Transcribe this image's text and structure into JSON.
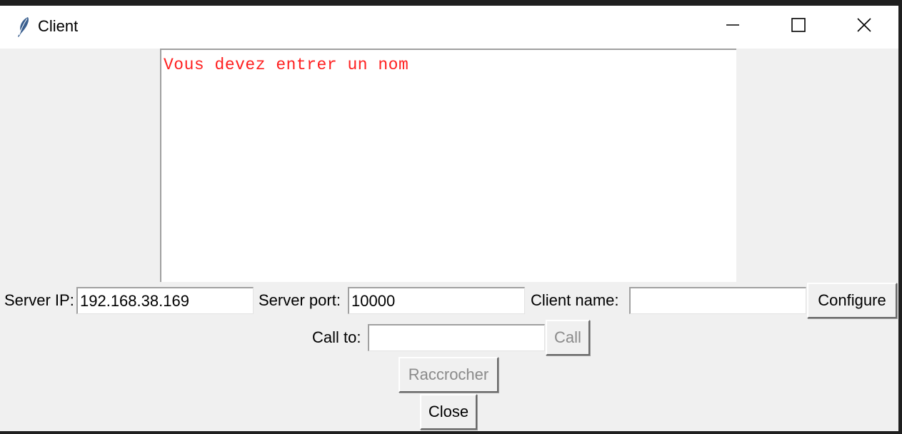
{
  "window": {
    "title": "Client",
    "icon": "feather-icon",
    "controls": [
      "minimize-icon",
      "maximize-icon",
      "close-icon"
    ]
  },
  "log": {
    "message": "Vous devez entrer un nom",
    "message_color": "#ff2020"
  },
  "config": {
    "server_ip_label": "Server IP:",
    "server_ip_value": "192.168.38.169",
    "server_port_label": "Server port:",
    "server_port_value": "10000",
    "client_name_label": "Client name:",
    "client_name_value": "",
    "configure_label": "Configure"
  },
  "call": {
    "call_to_label": "Call to:",
    "call_to_value": "",
    "call_label": "Call",
    "hangup_label": "Raccrocher"
  },
  "footer": {
    "close_label": "Close"
  }
}
